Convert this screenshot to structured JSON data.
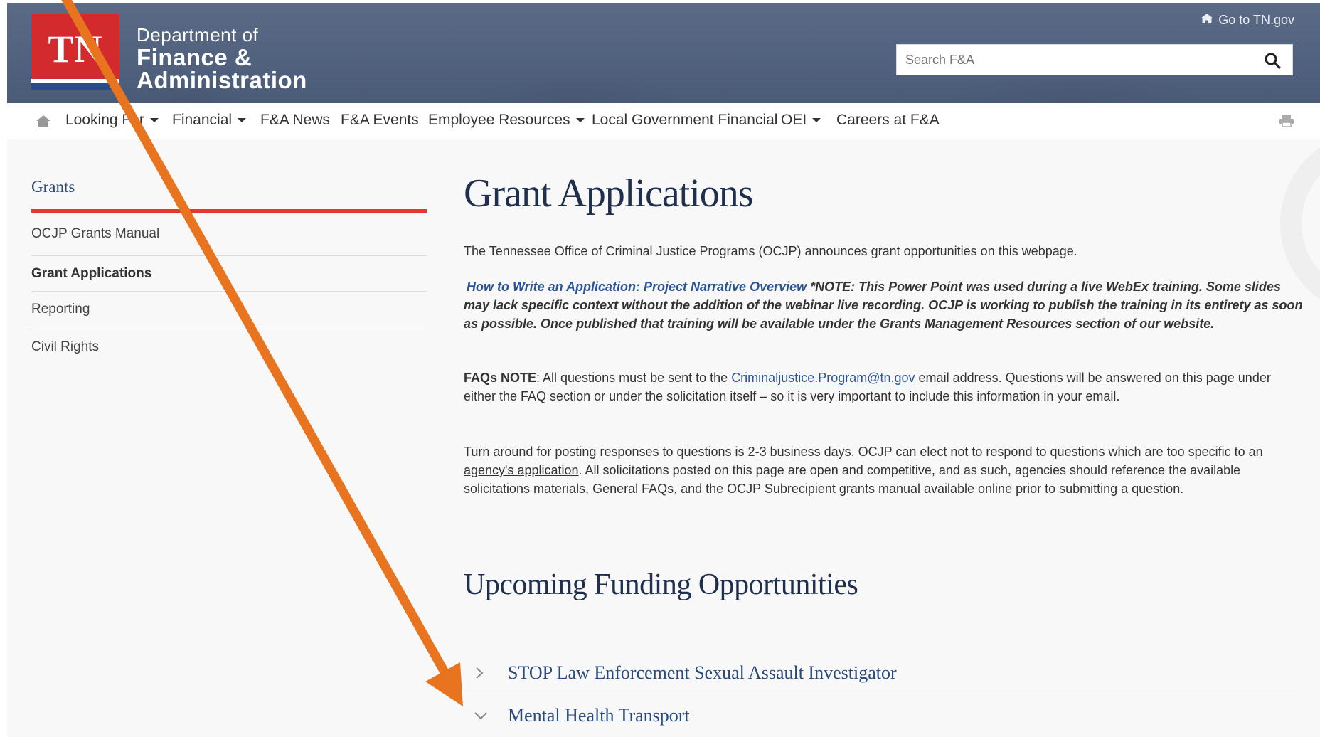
{
  "header": {
    "logo_text": "TN",
    "dept_line1": "Department of",
    "dept_line2": "Finance &",
    "dept_line3": "Administration",
    "goto_link": "Go to TN.gov",
    "search_placeholder": "Search F&A"
  },
  "nav": {
    "items": [
      {
        "label": "Looking For",
        "dropdown": true
      },
      {
        "label": "Financial",
        "dropdown": true
      },
      {
        "label": "F&A News",
        "dropdown": false
      },
      {
        "label": "F&A Events",
        "dropdown": false
      },
      {
        "label": "Employee Resources",
        "dropdown": true
      },
      {
        "label": "Local Government Financial",
        "dropdown": false
      },
      {
        "label": "OEI",
        "dropdown": true
      },
      {
        "label": "Careers at F&A",
        "dropdown": false
      }
    ]
  },
  "sidebar": {
    "title": "Grants",
    "items": [
      {
        "label": "OCJP Grants Manual",
        "active": false
      },
      {
        "label": "Grant Applications",
        "active": true
      },
      {
        "label": "Reporting",
        "active": false
      },
      {
        "label": "Civil Rights",
        "active": false
      }
    ]
  },
  "main": {
    "title": "Grant Applications",
    "intro": "The Tennessee Office of Criminal Justice Programs (OCJP) announces grant opportunities on this webpage.",
    "note_link": "How to Write an Application: Project Narrative Overview",
    "note_text": " *NOTE: This Power Point  was used during a live WebEx training. Some slides may lack specific context without the addition of the webinar live recording. OCJP is working to publish the training in its entirety as soon as possible. Once published that training will be available under the Grants Management Resources section of our website.",
    "faq_label": "FAQs NOTE",
    "faq_text1": ": All questions must be sent to the ",
    "faq_email": "Criminaljustice.Program@tn.gov",
    "faq_text2": " email address. Questions will be answered on this page under either the FAQ section or under the solicitation itself – so it is very important to include this information in your email.",
    "turn_text1": "Turn around for posting responses to questions is 2-3 business days. ",
    "turn_underlined": "OCJP can elect not to respond to questions which are too specific to an agency's application",
    "turn_text2": ". All solicitations posted on this page are open and competitive, and as such, agencies should reference the available solicitations materials, General FAQs, and the OCJP Subrecipient grants manual available online prior to submitting a question.",
    "section_title": "Upcoming Funding Opportunities",
    "accordions": [
      {
        "label": "STOP Law Enforcement Sexual Assault Investigator",
        "expanded": false
      },
      {
        "label": "Mental Health Transport",
        "expanded": true
      }
    ]
  },
  "colors": {
    "header_bg": "#4f607d",
    "logo_red": "#d32a2e",
    "sidebar_accent": "#e23b2e",
    "annotation_arrow": "#e8741f"
  }
}
